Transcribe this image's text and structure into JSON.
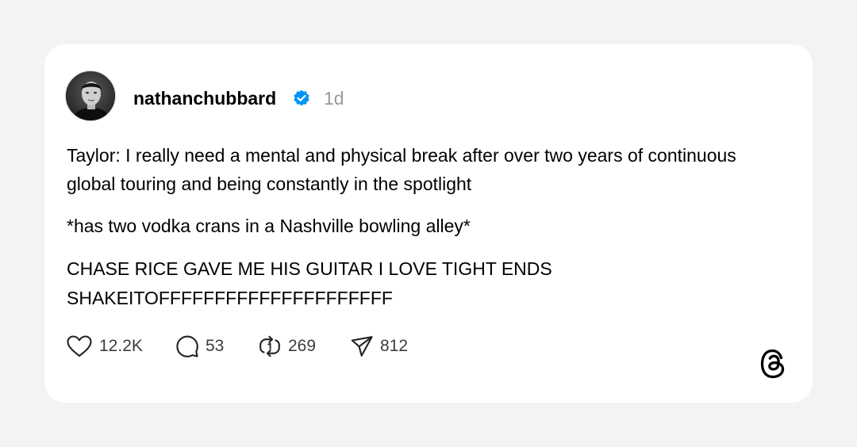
{
  "post": {
    "username": "nathanchubbard",
    "timestamp": "1d",
    "verified": true,
    "paragraphs": [
      "Taylor: I really need a mental and physical break after over two years of continuous global touring and being constantly in the spotlight",
      "*has two vodka crans in a Nashville bowling alley*",
      "CHASE RICE GAVE ME HIS GUITAR I LOVE TIGHT ENDS SHAKEITOFFFFFFFFFFFFFFFFFFFFF"
    ]
  },
  "actions": {
    "likes": "12.2K",
    "replies": "53",
    "reposts": "269",
    "shares": "812"
  },
  "icons": {
    "like": "heart-icon",
    "reply": "comment-icon",
    "repost": "repost-icon",
    "share": "send-icon",
    "brand": "threads-logo",
    "verified": "verified-badge-icon"
  },
  "colors": {
    "background": "#f3f3f3",
    "card": "#ffffff",
    "verified_blue": "#0095f6",
    "timestamp": "#999999"
  }
}
